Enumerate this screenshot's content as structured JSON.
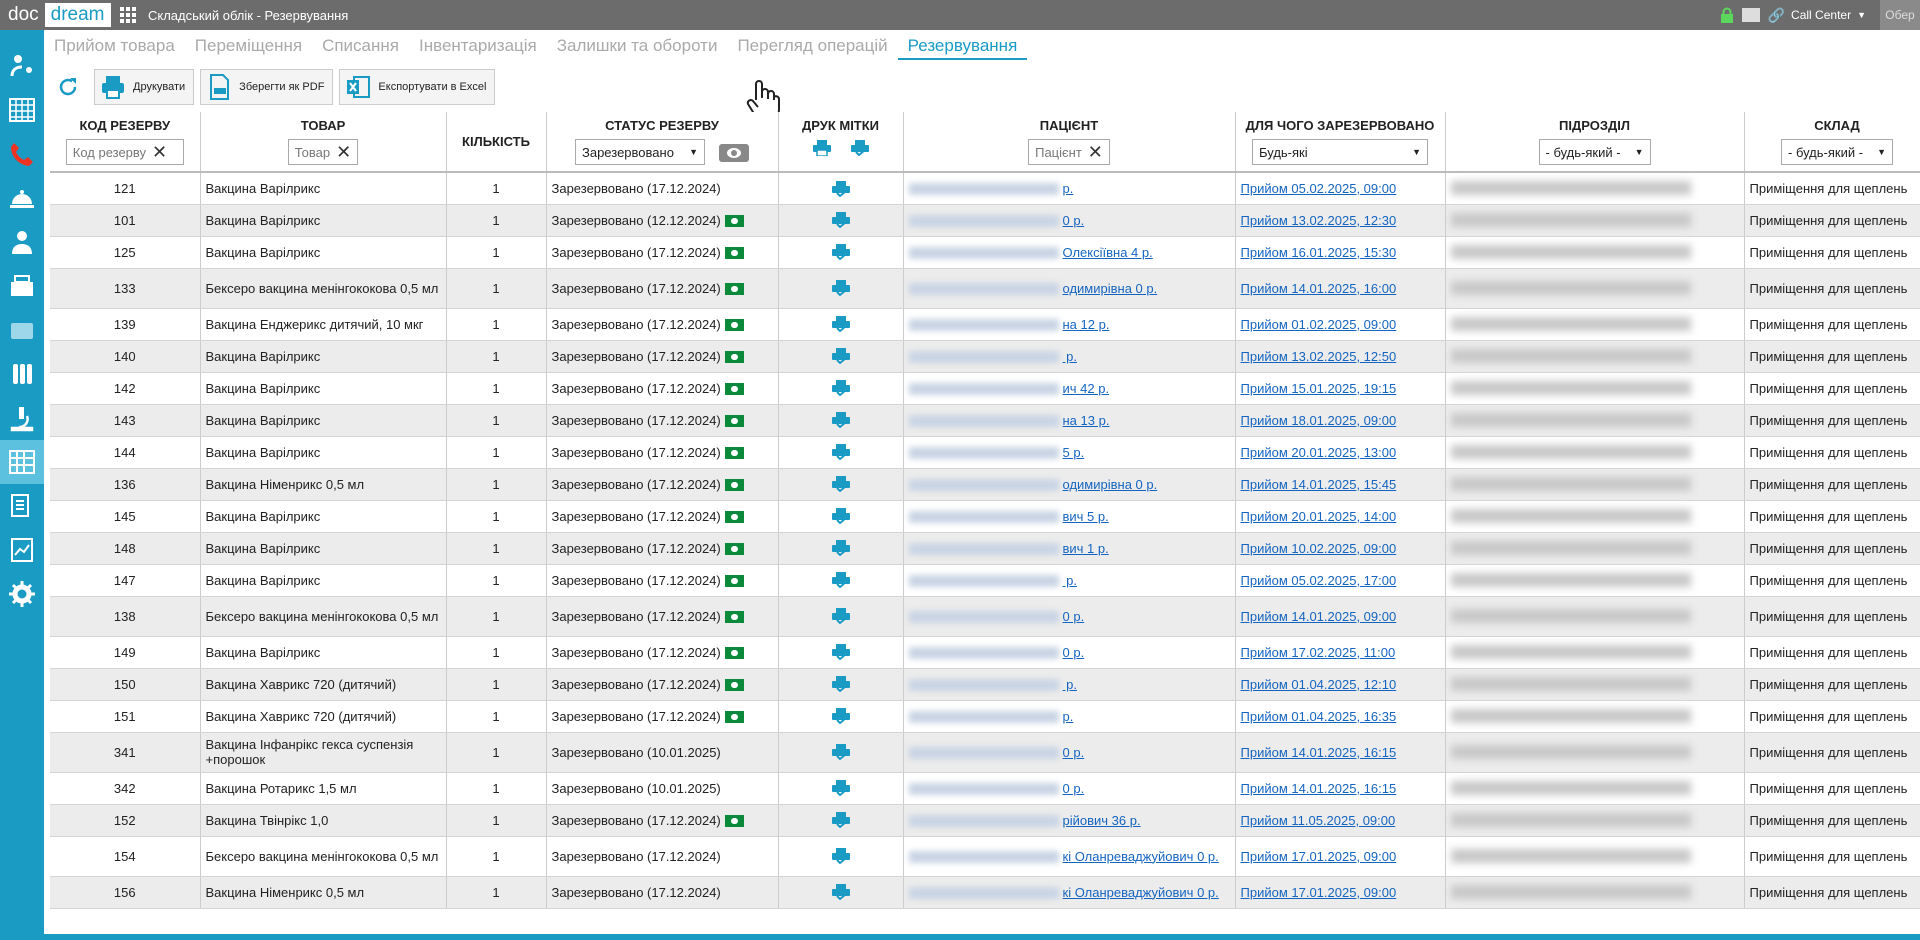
{
  "app": {
    "logo_doc": "doc",
    "logo_dream": "dream",
    "title": "Складський облік - Резервування"
  },
  "topbar": {
    "call_center": "Call Center",
    "obr": "Обер"
  },
  "tabs": [
    {
      "label": "Прийом товара",
      "active": false
    },
    {
      "label": "Переміщення",
      "active": false
    },
    {
      "label": "Списання",
      "active": false
    },
    {
      "label": "Інвентаризація",
      "active": false
    },
    {
      "label": "Залишки та обороти",
      "active": false
    },
    {
      "label": "Перегляд операцій",
      "active": false
    },
    {
      "label": "Резервування",
      "active": true
    }
  ],
  "toolbar": {
    "print": "Друкувати",
    "save_pdf": "Зберегти як PDF",
    "export_excel": "Експортувати в Excel"
  },
  "columns": {
    "code": "КОД РЕЗЕРВУ",
    "product": "ТОВАР",
    "qty": "КІЛЬКІСТЬ",
    "status": "СТАТУС РЕЗЕРВУ",
    "label_print": "ДРУК МІТКИ",
    "patient": "ПАЦІЄНТ",
    "purpose": "ДЛЯ ЧОГО ЗАРЕЗЕРВОВАНО",
    "division": "ПІДРОЗДІЛ",
    "warehouse": "СКЛАД"
  },
  "filters": {
    "code_placeholder": "Код резерву",
    "product_placeholder": "Товар",
    "status_value": "Зарезервовано",
    "patient_placeholder": "Пацієнт",
    "purpose_value": "Будь-які",
    "division_value": "- будь-який -",
    "warehouse_value": "- будь-який -"
  },
  "colors": {
    "accent": "#1a9bc4",
    "link": "#1565c0",
    "badge": "#0a8a3a",
    "topbar": "#6c6c6c"
  },
  "rows": [
    {
      "code": "121",
      "product": "Вакцина Варілрикс",
      "qty": "1",
      "status": "Зарезервовано (17.12.2024)",
      "badge": false,
      "patient": "р.",
      "purpose": "Прийом 05.02.2025, 09:00",
      "warehouse": "Приміщення для щеплень",
      "tall": false
    },
    {
      "code": "101",
      "product": "Вакцина Варілрикс",
      "qty": "1",
      "status": "Зарезервовано (12.12.2024)",
      "badge": true,
      "patient": "0  р.",
      "purpose": "Прийом 13.02.2025, 12:30",
      "warehouse": "Приміщення для щеплень",
      "tall": false
    },
    {
      "code": "125",
      "product": "Вакцина Варілрикс",
      "qty": "1",
      "status": "Зарезервовано (17.12.2024)",
      "badge": true,
      "patient": "Олексіївна 4  р.",
      "purpose": "Прийом 16.01.2025, 15:30",
      "warehouse": "Приміщення для щеплень",
      "tall": false
    },
    {
      "code": "133",
      "product": "Бексеро вакцина менінгококова 0,5 мл",
      "qty": "1",
      "status": "Зарезервовано (17.12.2024)",
      "badge": true,
      "patient": "одимирівна 0  р.",
      "purpose": "Прийом 14.01.2025, 16:00",
      "warehouse": "Приміщення для щеплень",
      "tall": true
    },
    {
      "code": "139",
      "product": "Вакцина Енджерикс дитячий, 10 мкг",
      "qty": "1",
      "status": "Зарезервовано (17.12.2024)",
      "badge": true,
      "patient": "на 12  р.",
      "purpose": "Прийом 01.02.2025, 09:00",
      "warehouse": "Приміщення для щеплень",
      "tall": false
    },
    {
      "code": "140",
      "product": "Вакцина Варілрикс",
      "qty": "1",
      "status": "Зарезервовано (17.12.2024)",
      "badge": true,
      "patient": " р.",
      "purpose": "Прийом 13.02.2025, 12:50",
      "warehouse": "Приміщення для щеплень",
      "tall": false
    },
    {
      "code": "142",
      "product": "Вакцина Варілрикс",
      "qty": "1",
      "status": "Зарезервовано (17.12.2024)",
      "badge": true,
      "patient": "ич 42  р.",
      "purpose": "Прийом 15.01.2025, 19:15",
      "warehouse": "Приміщення для щеплень",
      "tall": false
    },
    {
      "code": "143",
      "product": "Вакцина Варілрикс",
      "qty": "1",
      "status": "Зарезервовано (17.12.2024)",
      "badge": true,
      "patient": "на 13  р.",
      "purpose": "Прийом 18.01.2025, 09:00",
      "warehouse": "Приміщення для щеплень",
      "tall": false
    },
    {
      "code": "144",
      "product": "Вакцина Варілрикс",
      "qty": "1",
      "status": "Зарезервовано (17.12.2024)",
      "badge": true,
      "patient": "5  р.",
      "purpose": "Прийом 20.01.2025, 13:00",
      "warehouse": "Приміщення для щеплень",
      "tall": false
    },
    {
      "code": "136",
      "product": "Вакцина Німенрикс 0,5 мл",
      "qty": "1",
      "status": "Зарезервовано (17.12.2024)",
      "badge": true,
      "patient": "одимирівна 0  р.",
      "purpose": "Прийом 14.01.2025, 15:45",
      "warehouse": "Приміщення для щеплень",
      "tall": false
    },
    {
      "code": "145",
      "product": "Вакцина Варілрикс",
      "qty": "1",
      "status": "Зарезервовано (17.12.2024)",
      "badge": true,
      "patient": "вич 5  р.",
      "purpose": "Прийом 20.01.2025, 14:00",
      "warehouse": "Приміщення для щеплень",
      "tall": false
    },
    {
      "code": "148",
      "product": "Вакцина Варілрикс",
      "qty": "1",
      "status": "Зарезервовано (17.12.2024)",
      "badge": true,
      "patient": "вич 1  р.",
      "purpose": "Прийом 10.02.2025, 09:00",
      "warehouse": "Приміщення для щеплень",
      "tall": false
    },
    {
      "code": "147",
      "product": "Вакцина Варілрикс",
      "qty": "1",
      "status": "Зарезервовано (17.12.2024)",
      "badge": true,
      "patient": " р.",
      "purpose": "Прийом 05.02.2025, 17:00",
      "warehouse": "Приміщення для щеплень",
      "tall": false
    },
    {
      "code": "138",
      "product": "Бексеро вакцина менінгококова 0,5 мл",
      "qty": "1",
      "status": "Зарезервовано (17.12.2024)",
      "badge": true,
      "patient": "0  р.",
      "purpose": "Прийом 14.01.2025, 09:00",
      "warehouse": "Приміщення для щеплень",
      "tall": true
    },
    {
      "code": "149",
      "product": "Вакцина Варілрикс",
      "qty": "1",
      "status": "Зарезервовано (17.12.2024)",
      "badge": true,
      "patient": "0  р.",
      "purpose": "Прийом 17.02.2025, 11:00",
      "warehouse": "Приміщення для щеплень",
      "tall": false
    },
    {
      "code": "150",
      "product": "Вакцина Хаврикс 720 (дитячий)",
      "qty": "1",
      "status": "Зарезервовано (17.12.2024)",
      "badge": true,
      "patient": " р.",
      "purpose": "Прийом 01.04.2025, 12:10",
      "warehouse": "Приміщення для щеплень",
      "tall": false
    },
    {
      "code": "151",
      "product": "Вакцина Хаврикс 720 (дитячий)",
      "qty": "1",
      "status": "Зарезервовано (17.12.2024)",
      "badge": true,
      "patient": "р.",
      "purpose": "Прийом 01.04.2025, 16:35",
      "warehouse": "Приміщення для щеплень",
      "tall": false
    },
    {
      "code": "341",
      "product": "Вакцина Інфанрікс гекса суспензія +порошок",
      "qty": "1",
      "status": "Зарезервовано (10.01.2025)",
      "badge": false,
      "patient": "0  р.",
      "purpose": "Прийом 14.01.2025, 16:15",
      "warehouse": "Приміщення для щеплень",
      "tall": true
    },
    {
      "code": "342",
      "product": "Вакцина Ротарикс 1,5 мл",
      "qty": "1",
      "status": "Зарезервовано (10.01.2025)",
      "badge": false,
      "patient": "0  р.",
      "purpose": "Прийом 14.01.2025, 16:15",
      "warehouse": "Приміщення для щеплень",
      "tall": false
    },
    {
      "code": "152",
      "product": "Вакцина Твінрікс 1,0",
      "qty": "1",
      "status": "Зарезервовано (17.12.2024)",
      "badge": true,
      "patient": "рійович 36  р.",
      "purpose": "Прийом 11.05.2025, 09:00",
      "warehouse": "Приміщення для щеплень",
      "tall": false
    },
    {
      "code": "154",
      "product": "Бексеро вакцина менінгококова 0,5 мл",
      "qty": "1",
      "status": "Зарезервовано (17.12.2024)",
      "badge": false,
      "patient": "кі Оланреваджуйович 0  р.",
      "purpose": "Прийом 17.01.2025, 09:00",
      "warehouse": "Приміщення для щеплень",
      "tall": true
    },
    {
      "code": "156",
      "product": "Вакцина Німенрикс 0,5 мл",
      "qty": "1",
      "status": "Зарезервовано (17.12.2024)",
      "badge": false,
      "patient": "кі Оланреваджуйович 0  р.",
      "purpose": "Прийом 17.01.2025, 09:00",
      "warehouse": "Приміщення для щеплень",
      "tall": false
    }
  ]
}
